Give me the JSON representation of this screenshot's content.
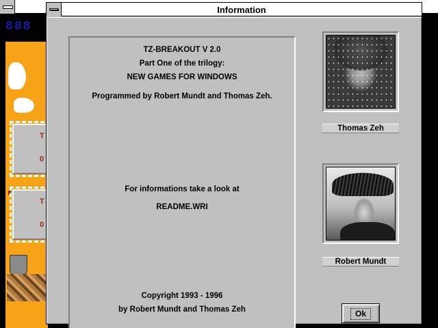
{
  "background_window": {
    "title": "",
    "score_text": "888"
  },
  "dialog": {
    "title": "Information",
    "info_lines": [
      "TZ-BREAKOUT V 2.0",
      "Part One of the trilogy:",
      "NEW GAMES FOR WINDOWS",
      "Programmed by Robert Mundt and Thomas Zeh.",
      "For informations take a look at",
      "README.WRI",
      "Copyright 1993 - 1996",
      "by Robert Mundt and Thomas Zeh"
    ],
    "people": [
      {
        "name": "Thomas Zeh"
      },
      {
        "name": "Robert Mundt"
      }
    ],
    "ok_button": {
      "label": "Ok"
    }
  },
  "colors": {
    "dialog_face": "#c0c0c0",
    "titlebar": "#ffffff",
    "game_background": "#f7a317"
  }
}
